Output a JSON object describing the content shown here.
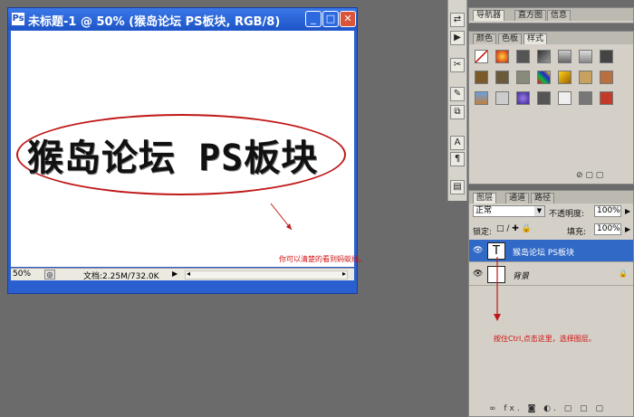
{
  "document": {
    "title": "未标题-1 @ 50% (猴岛论坛 PS板块, RGB/8)",
    "canvas_text": "猴岛论坛 PS板块",
    "annotation": "你可以清楚的看到蚂蚁线。",
    "status": {
      "zoom": "50%",
      "doc_info": "文档:2.25M/732.0K"
    }
  },
  "panels": {
    "navigator_tabs": [
      "导航器",
      "直方图",
      "信息"
    ],
    "style_tabs": [
      "颜色",
      "色板",
      "样式"
    ],
    "layer_tabs": [
      "图层",
      "通道",
      "路径"
    ],
    "blend_mode": "正常",
    "opacity_label": "不透明度:",
    "opacity_value": "100%",
    "lock_label": "锁定:",
    "fill_label": "填充:",
    "fill_value": "100%",
    "layers": [
      {
        "name": "猴岛论坛 PS板块",
        "thumb": "T"
      },
      {
        "name": "背景",
        "thumb": ""
      }
    ],
    "annotation": "按住Ctrl,点击这里，选择图层。"
  }
}
